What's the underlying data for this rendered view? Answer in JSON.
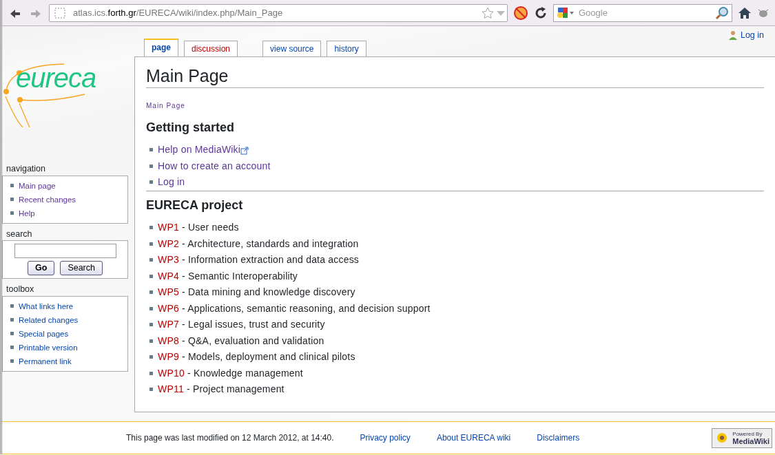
{
  "browser": {
    "url": "atlas.ics.**forth.gr**/EURECA/wiki/index.php/Main_Page",
    "search_placeholder": "Google"
  },
  "personal": {
    "label": "Log in"
  },
  "tabs": [
    {
      "label": "page",
      "selected": true,
      "kind": "plain"
    },
    {
      "label": "discussion",
      "selected": false,
      "kind": "new"
    },
    {
      "label": "view source",
      "selected": false,
      "kind": "plain"
    },
    {
      "label": "history",
      "selected": false,
      "kind": "plain"
    }
  ],
  "logo": {
    "text": "eureca"
  },
  "sidebar": {
    "navigation": {
      "title": "navigation",
      "items": [
        {
          "label": "Main page",
          "kind": "visited"
        },
        {
          "label": "Recent changes",
          "kind": "visited"
        },
        {
          "label": "Help",
          "kind": "visited"
        }
      ]
    },
    "search": {
      "title": "search",
      "buttons": [
        "Go",
        "Search"
      ]
    },
    "toolbox": {
      "title": "toolbox",
      "items": [
        {
          "label": "What links here",
          "kind": "plain"
        },
        {
          "label": "Related changes",
          "kind": "plain"
        },
        {
          "label": "Special pages",
          "kind": "plain"
        },
        {
          "label": "Printable version",
          "kind": "plain"
        },
        {
          "label": "Permanent link",
          "kind": "plain"
        }
      ]
    }
  },
  "content": {
    "title": "Main Page",
    "breadcrumb": "Main Page",
    "sections": [
      {
        "heading": "Getting started",
        "items": [
          {
            "link": "Help on MediaWiki",
            "kind": "external"
          },
          {
            "link": "How to create an account",
            "kind": "visited"
          },
          {
            "link": "Log in",
            "kind": "visited"
          }
        ]
      },
      {
        "heading": "EURECA project",
        "items": [
          {
            "link": "WP1",
            "kind": "new",
            "text": " - User needs"
          },
          {
            "link": "WP2",
            "kind": "new",
            "text": " - Architecture, standards and integration"
          },
          {
            "link": "WP3",
            "kind": "new",
            "text": " - Information extraction and data access"
          },
          {
            "link": "WP4",
            "kind": "new",
            "text": " - Semantic Interoperability"
          },
          {
            "link": "WP5",
            "kind": "new",
            "text": " - Data mining and knowledge discovery"
          },
          {
            "link": "WP6",
            "kind": "new",
            "text": " - Applications, semantic reasoning, and decision support"
          },
          {
            "link": "WP7",
            "kind": "new",
            "text": " - Legal issues, trust and security"
          },
          {
            "link": "WP8",
            "kind": "new",
            "text": " - Q&A, evaluation and validation"
          },
          {
            "link": "WP9",
            "kind": "new",
            "text": " - Models, deployment and clinical pilots"
          },
          {
            "link": "WP10",
            "kind": "new",
            "text": " - Knowledge management"
          },
          {
            "link": "WP11",
            "kind": "new",
            "text": " - Project management"
          }
        ]
      }
    ]
  },
  "footer": {
    "modified": "This page was last modified on 12 March 2012, at 14:40.",
    "links": [
      "Privacy policy",
      "About EURECA wiki",
      "Disclaimers"
    ],
    "badge_top": "Powered By",
    "badge_bottom": "MediaWiki"
  }
}
